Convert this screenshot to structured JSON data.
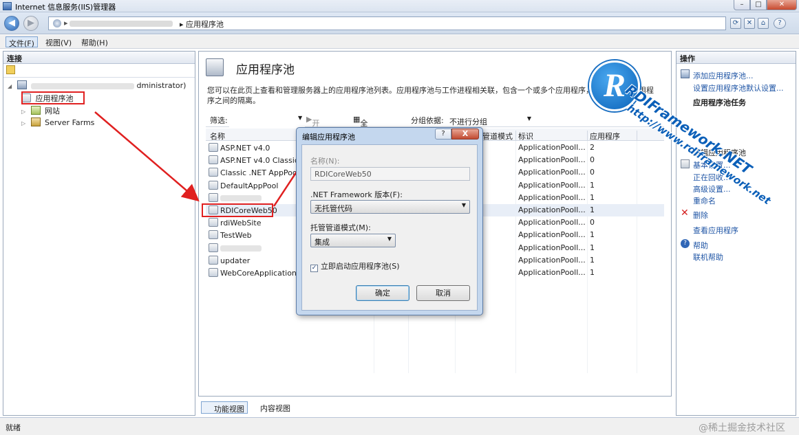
{
  "window": {
    "title": "Internet 信息服务(IIS)管理器"
  },
  "address": {
    "breadcrumb_current": "应用程序池",
    "separator": "▸"
  },
  "menu": [
    "文件(F)",
    "视图(V)",
    "帮助(H)"
  ],
  "connections": {
    "header": "连接",
    "server_suffix": "dministrator)",
    "items": [
      "应用程序池",
      "网站",
      "Server Farms"
    ]
  },
  "page": {
    "title": "应用程序池",
    "description": "您可以在此页上查看和管理服务器上的应用程序池列表。应用程序池与工作进程相关联，包含一个或多个应用程序，并提供不同应用程序之间的隔离。",
    "filter_label": "筛选:",
    "start_label": "开始(G)",
    "show_all_label": "全部显示(A)",
    "group_label": "分组依据:",
    "group_value": "不进行分组",
    "columns": [
      "名称",
      "管道模式",
      "标识",
      "应用程序"
    ],
    "pools": [
      {
        "name": "ASP.NET v4.0",
        "identity": "ApplicationPooll...",
        "apps": "2"
      },
      {
        "name": "ASP.NET v4.0 Classic",
        "identity": "ApplicationPooll...",
        "apps": "0"
      },
      {
        "name": "Classic .NET AppPool",
        "identity": "ApplicationPooll...",
        "apps": "0"
      },
      {
        "name": "DefaultAppPool",
        "identity": "ApplicationPooll...",
        "apps": "1"
      },
      {
        "name": "",
        "identity": "ApplicationPooll...",
        "apps": "1"
      },
      {
        "name": "RDICoreWeb50",
        "identity": "ApplicationPooll...",
        "apps": "1"
      },
      {
        "name": "rdiWebSite",
        "identity": "ApplicationPooll...",
        "apps": "0"
      },
      {
        "name": "TestWeb",
        "identity": "ApplicationPooll...",
        "apps": "1"
      },
      {
        "name": "",
        "identity": "ApplicationPooll...",
        "apps": "1"
      },
      {
        "name": "updater",
        "identity": "ApplicationPooll...",
        "apps": "1"
      },
      {
        "name": "WebCoreApplicationT",
        "identity": "ApplicationPooll...",
        "apps": "1"
      }
    ],
    "view_tabs": [
      "功能视图",
      "内容视图"
    ]
  },
  "actions": {
    "header": "操作",
    "add_pool": "添加应用程序池...",
    "set_defaults": "设置应用程序池默认设置...",
    "tasks_header": "应用程序池任务",
    "edit_pool": "编辑应用程序池",
    "basic_settings": "基本设置...",
    "recycling": "正在回收...",
    "advanced": "高级设置...",
    "rename": "重命名",
    "delete": "删除",
    "view_apps": "查看应用程序",
    "help": "帮助",
    "online_help": "联机帮助"
  },
  "dialog": {
    "title": "编辑应用程序池",
    "help_btn": "?",
    "close_btn": "X",
    "name_label": "名称(N):",
    "name_value": "RDICoreWeb50",
    "framework_label": ".NET Framework 版本(F):",
    "framework_value": "无托管代码",
    "pipeline_label": "托管管道模式(M):",
    "pipeline_value": "集成",
    "autostart_label": "立即启动应用程序池(S)",
    "autostart_checked": true,
    "ok": "确定",
    "cancel": "取消"
  },
  "status": {
    "text": "就绪"
  },
  "overlay": {
    "logo_letter": "R",
    "brand": "RDIFramework.NET",
    "url": "http://www.rdiframework.net"
  },
  "watermark": "@稀土掘金技术社区",
  "colors": {
    "highlight": "#e02020",
    "link": "#1f55a5"
  }
}
